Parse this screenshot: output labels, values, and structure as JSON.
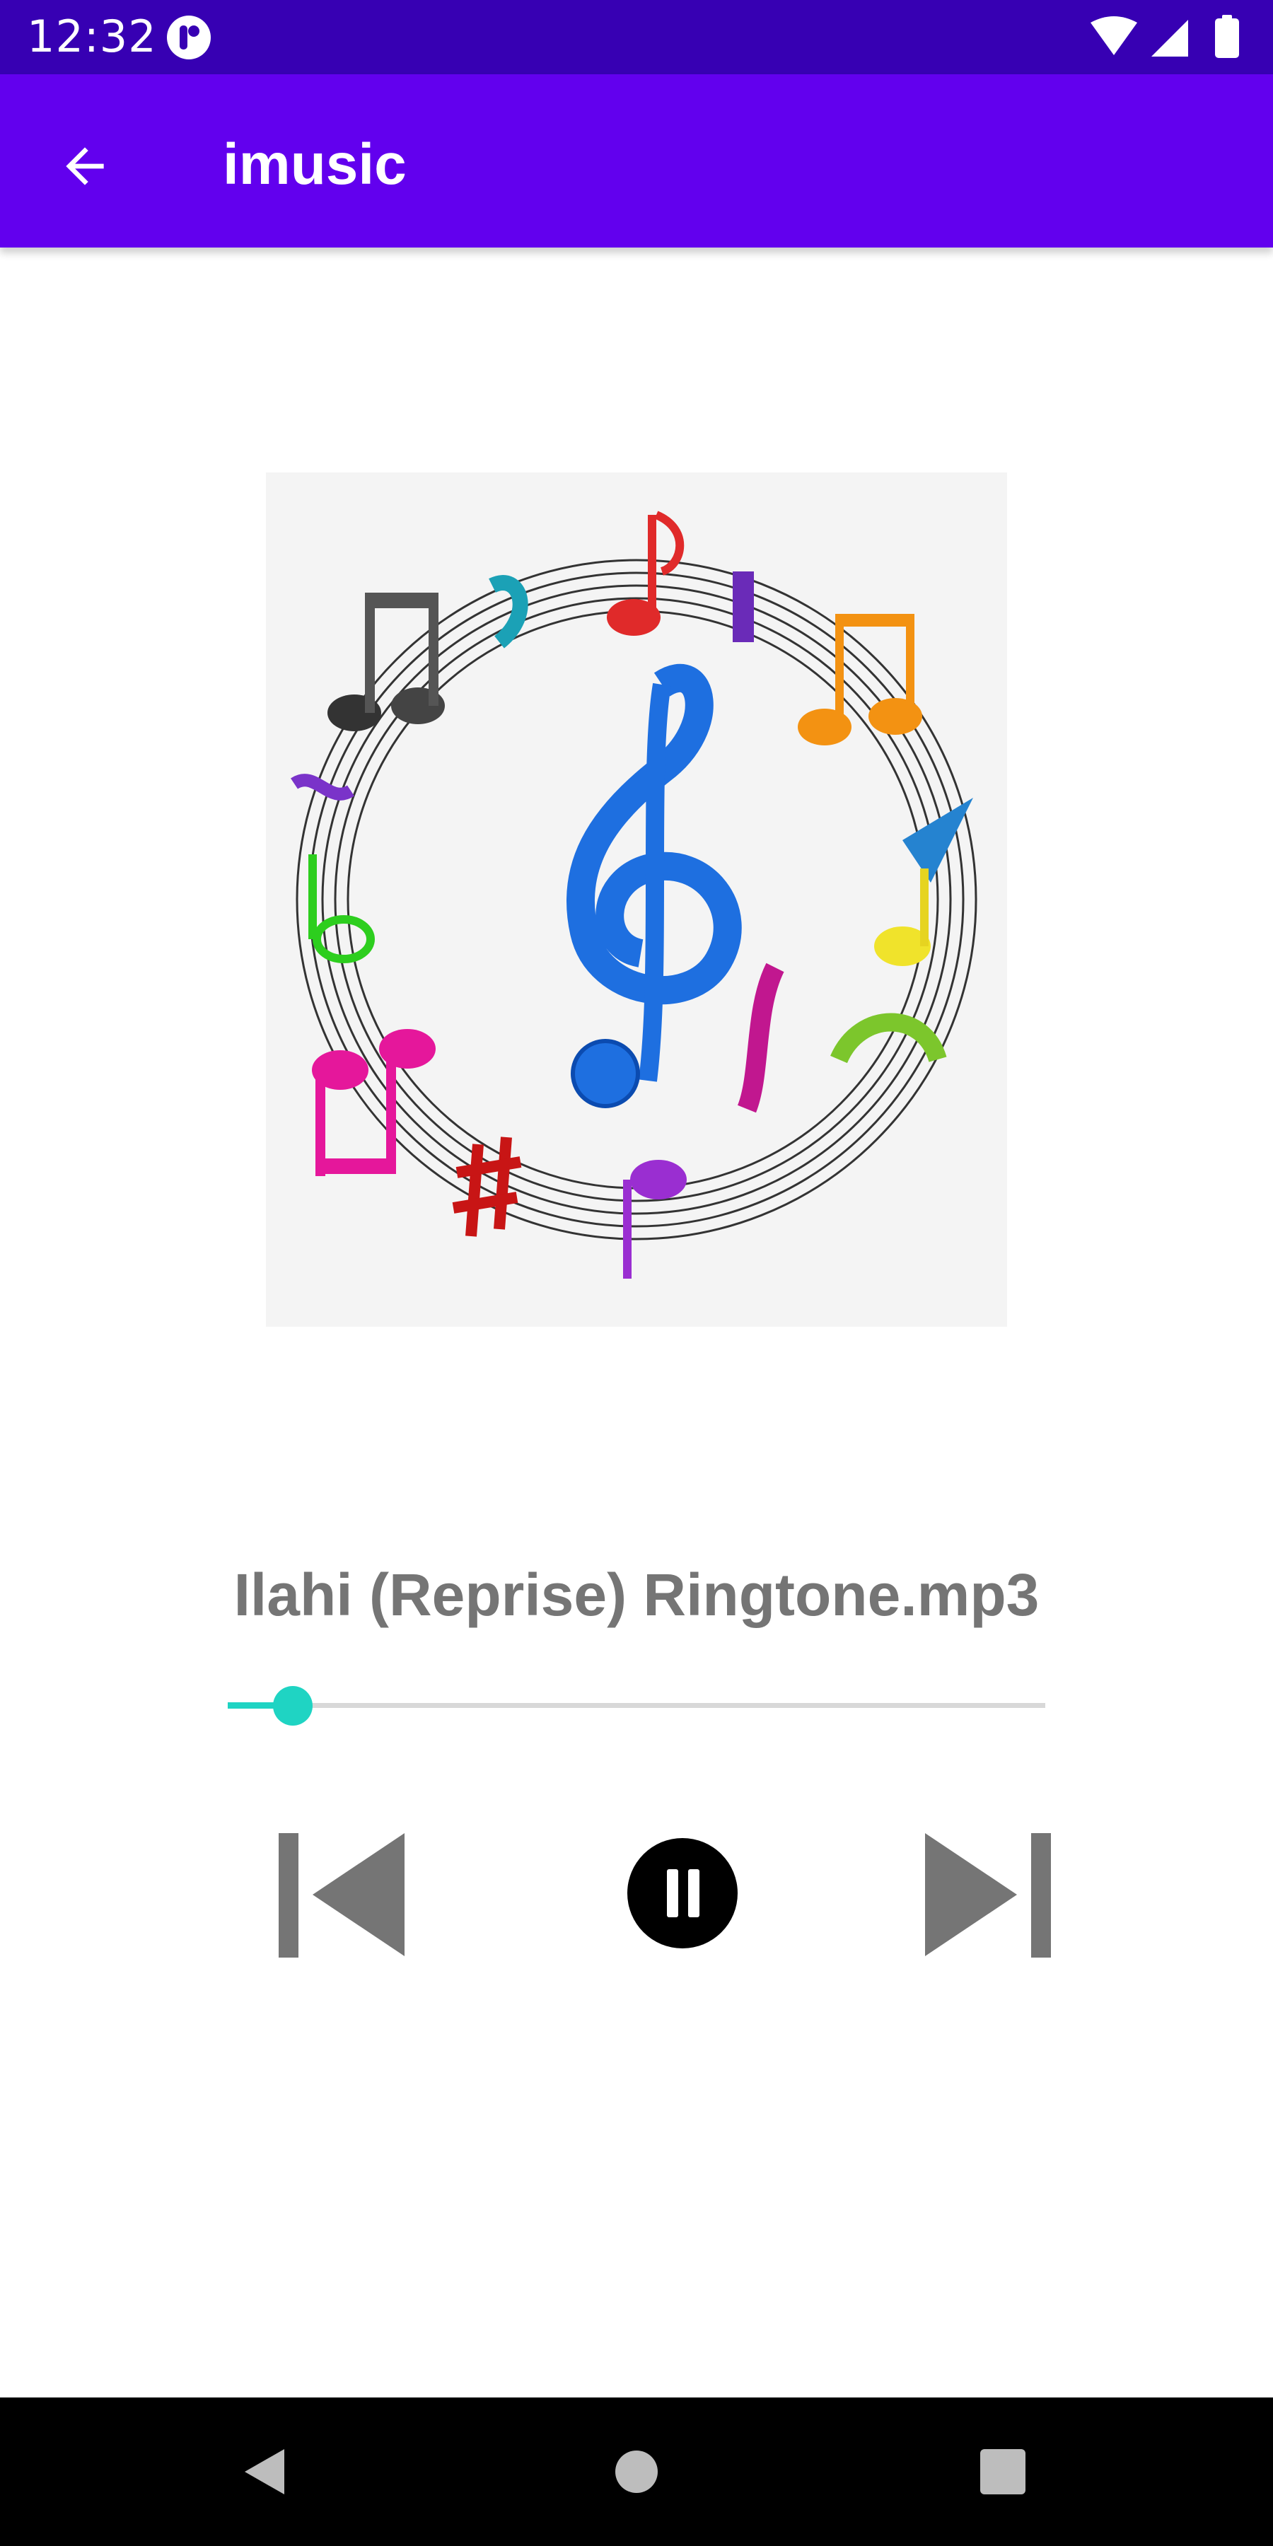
{
  "status_bar": {
    "time": "12:32",
    "icons": [
      "notification-badge-icon",
      "wifi-icon",
      "cell-signal-icon",
      "battery-icon"
    ],
    "color": "#3700b3"
  },
  "app_bar": {
    "title": "imusic",
    "back_icon": "arrow-left-icon",
    "color": "#6200ee"
  },
  "album_art": {
    "icon": "music-notes-circle-treble-clef"
  },
  "player": {
    "song_title": "Ilahi (Reprise) Ringtone.mp3",
    "progress": 0.08,
    "accent_color": "#1fd4c3",
    "controls": {
      "previous_icon": "skip-previous-icon",
      "pause_icon": "pause-icon",
      "next_icon": "skip-next-icon"
    }
  },
  "nav_bar": {
    "buttons": [
      "nav-back-icon",
      "nav-home-icon",
      "nav-recents-icon"
    ]
  }
}
